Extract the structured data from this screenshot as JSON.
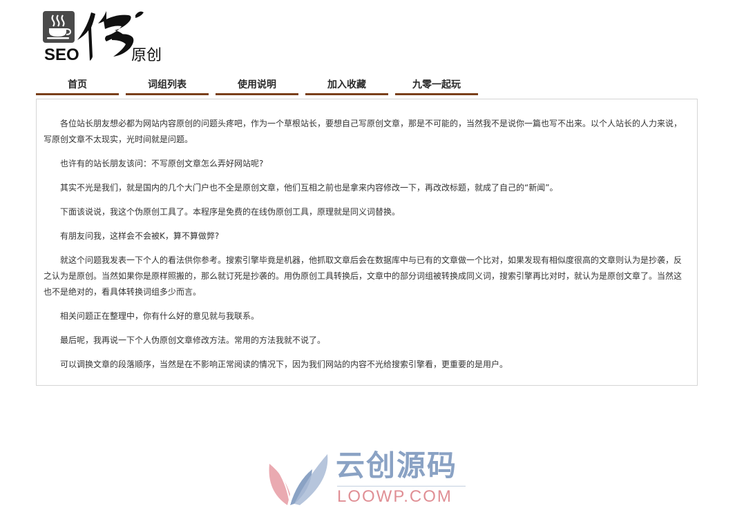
{
  "logo": {
    "seo_text": "SEO",
    "brand_text": "原创",
    "calligraphy_icon": "calligraphy-wei-icon",
    "cup_icon": "coffee-cup-icon"
  },
  "nav": {
    "items": [
      {
        "label": "首页"
      },
      {
        "label": "词组列表"
      },
      {
        "label": "使用说明"
      },
      {
        "label": "加入收藏"
      },
      {
        "label": "九零一起玩"
      }
    ],
    "accent_color": "#7a3f1a"
  },
  "content": {
    "paragraphs": [
      "各位站长朋友想必都为网站内容原创的问题头疼吧，作为一个草根站长，要想自己写原创文章，那是不可能的，当然我不是说你一篇也写不出来。以个人站长的人力来说，写原创文章不太现实，光时间就是问题。",
      "也许有的站长朋友该问：不写原创文章怎么弄好网站呢?",
      "其实不光是我们，就是国内的几个大门户也不全是原创文章，他们互相之前也是拿来内容修改一下，再改改标题，就成了自己的“新闻”。",
      "下面该说说，我这个伪原创工具了。本程序是免费的在线伪原创工具，原理就是同义词替换。",
      "有朋友问我，这样会不会被K，算不算做弊?",
      "就这个问题我发表一下个人的看法供你参考。搜索引擎毕竟是机器，他抓取文章后会在数据库中与已有的文章做一个比对，如果发现有相似度很高的文章则认为是抄袭，反之认为是原创。当然如果你是原样照搬的，那么就订死是抄袭的。用伪原创工具转换后，文章中的部分词组被转换成同义词，搜索引擎再比对时，就认为是原创文章了。当然这也不是绝对的，看具体转换词组多少而言。",
      "相关问题正在整理中，你有什么好的意见就与我联系。",
      "最后呢，我再说一下个人伪原创文章修改方法。常用的方法我就不说了。",
      "可以调换文章的段落顺序，当然是在不影响正常阅读的情况下，因为我们网站的内容不光给搜索引擎看，更重要的是用户。"
    ]
  },
  "watermark": {
    "name": "云创源码",
    "domain": "LOOWP.COM",
    "icon": "leaf-logo-icon",
    "colors": {
      "blue": "#8aa2c4",
      "pink": "#e08f95"
    }
  }
}
